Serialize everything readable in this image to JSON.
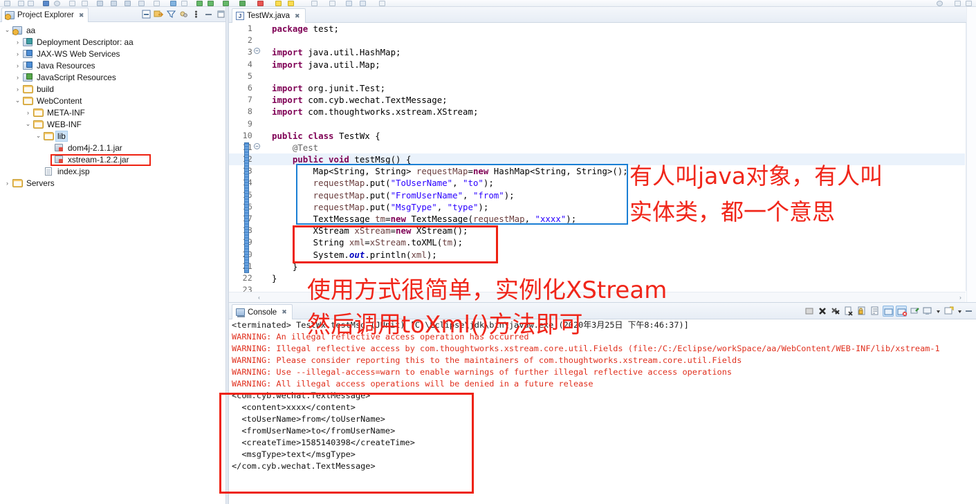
{
  "window": {
    "ide": "Eclipse IDE"
  },
  "project_explorer": {
    "tab_label": "Project Explorer",
    "tab_close": "✖",
    "tools": [
      {
        "name": "collapse-all-icon",
        "title": "Collapse All"
      },
      {
        "name": "link-with-editor-icon",
        "title": "Link with Editor"
      },
      {
        "name": "filter-icon",
        "title": "Filters"
      },
      {
        "name": "customize-view-icon",
        "title": "Customize View"
      },
      {
        "name": "view-menu-icon",
        "title": "View Menu"
      },
      {
        "name": "minimize-icon",
        "title": "Minimize"
      },
      {
        "name": "maximize-icon",
        "title": "Maximize"
      }
    ],
    "tree": [
      {
        "label": "aa",
        "depth": 0,
        "arrow": "⌄",
        "icon": "project-icon",
        "selected": false
      },
      {
        "label": "Deployment Descriptor: aa",
        "depth": 1,
        "arrow": "›",
        "icon": "deployment-descriptor-icon",
        "selected": false
      },
      {
        "label": "JAX-WS Web Services",
        "depth": 1,
        "arrow": "›",
        "icon": "web-services-icon",
        "selected": false
      },
      {
        "label": "Java Resources",
        "depth": 1,
        "arrow": "›",
        "icon": "java-resources-icon",
        "selected": false
      },
      {
        "label": "JavaScript Resources",
        "depth": 1,
        "arrow": "›",
        "icon": "javascript-resources-icon",
        "selected": false
      },
      {
        "label": "build",
        "depth": 1,
        "arrow": "›",
        "icon": "folder-icon",
        "selected": false
      },
      {
        "label": "WebContent",
        "depth": 1,
        "arrow": "⌄",
        "icon": "folder-icon",
        "selected": false
      },
      {
        "label": "META-INF",
        "depth": 2,
        "arrow": "›",
        "icon": "folder-icon",
        "selected": false
      },
      {
        "label": "WEB-INF",
        "depth": 2,
        "arrow": "⌄",
        "icon": "folder-icon",
        "selected": false
      },
      {
        "label": "lib",
        "depth": 3,
        "arrow": "⌄",
        "icon": "folder-icon",
        "selected": true
      },
      {
        "label": "dom4j-2.1.1.jar",
        "depth": 4,
        "arrow": "",
        "icon": "jar-icon",
        "selected": false
      },
      {
        "label": "xstream-1.2.2.jar",
        "depth": 4,
        "arrow": "",
        "icon": "jar-icon",
        "selected": false
      },
      {
        "label": "index.jsp",
        "depth": 3,
        "arrow": "",
        "icon": "jsp-file-icon",
        "selected": false
      },
      {
        "label": "Servers",
        "depth": 0,
        "arrow": "›",
        "icon": "folder-icon",
        "selected": false
      }
    ]
  },
  "editor": {
    "tab_label": "TestWx.java",
    "tab_icon_letter": "J",
    "tab_close": "✖",
    "code_lines": [
      {
        "num": "1",
        "fold": "",
        "highlight": false,
        "tokens": [
          {
            "t": "kw",
            "s": "package"
          },
          {
            "t": "pln",
            "s": " test;"
          }
        ]
      },
      {
        "num": "2",
        "fold": "",
        "highlight": false,
        "tokens": []
      },
      {
        "num": "3",
        "fold": "⊖",
        "highlight": false,
        "tokens": [
          {
            "t": "kw",
            "s": "import"
          },
          {
            "t": "pln",
            "s": " java.util.HashMap;"
          }
        ]
      },
      {
        "num": "4",
        "fold": "",
        "highlight": false,
        "tokens": [
          {
            "t": "kw",
            "s": "import"
          },
          {
            "t": "pln",
            "s": " java.util.Map;"
          }
        ]
      },
      {
        "num": "5",
        "fold": "",
        "highlight": false,
        "tokens": []
      },
      {
        "num": "6",
        "fold": "",
        "highlight": false,
        "tokens": [
          {
            "t": "kw",
            "s": "import"
          },
          {
            "t": "pln",
            "s": " org.junit.Test;"
          }
        ]
      },
      {
        "num": "7",
        "fold": "",
        "highlight": false,
        "tokens": [
          {
            "t": "kw",
            "s": "import"
          },
          {
            "t": "pln",
            "s": " com.cyb.wechat.TextMessage;"
          }
        ]
      },
      {
        "num": "8",
        "fold": "",
        "highlight": false,
        "tokens": [
          {
            "t": "kw",
            "s": "import"
          },
          {
            "t": "pln",
            "s": " com.thoughtworks.xstream.XStream;"
          }
        ]
      },
      {
        "num": "9",
        "fold": "",
        "highlight": false,
        "tokens": []
      },
      {
        "num": "10",
        "fold": "",
        "highlight": false,
        "tokens": [
          {
            "t": "kw",
            "s": "public class"
          },
          {
            "t": "pln",
            "s": " TestWx {"
          }
        ]
      },
      {
        "num": "11",
        "fold": "⊖",
        "highlight": false,
        "tokens": [
          {
            "t": "ann",
            "s": "    @Test"
          }
        ]
      },
      {
        "num": "12",
        "fold": "",
        "highlight": true,
        "tokens": [
          {
            "t": "kw",
            "s": "    public void"
          },
          {
            "t": "pln",
            "s": " testMsg() {"
          }
        ]
      },
      {
        "num": "13",
        "fold": "",
        "highlight": false,
        "tokens": [
          {
            "t": "pln",
            "s": "        Map<String, String> "
          },
          {
            "t": "loc",
            "s": "requestMap"
          },
          {
            "t": "pln",
            "s": "="
          },
          {
            "t": "kw",
            "s": "new"
          },
          {
            "t": "pln",
            "s": " HashMap<String, String>();"
          }
        ]
      },
      {
        "num": "14",
        "fold": "",
        "highlight": false,
        "tokens": [
          {
            "t": "loc",
            "s": "        requestMap"
          },
          {
            "t": "pln",
            "s": ".put("
          },
          {
            "t": "str",
            "s": "\"ToUserName\""
          },
          {
            "t": "pln",
            "s": ", "
          },
          {
            "t": "str",
            "s": "\"to\""
          },
          {
            "t": "pln",
            "s": ");"
          }
        ]
      },
      {
        "num": "15",
        "fold": "",
        "highlight": false,
        "tokens": [
          {
            "t": "loc",
            "s": "        requestMap"
          },
          {
            "t": "pln",
            "s": ".put("
          },
          {
            "t": "str",
            "s": "\"FromUserName\""
          },
          {
            "t": "pln",
            "s": ", "
          },
          {
            "t": "str",
            "s": "\"from\""
          },
          {
            "t": "pln",
            "s": ");"
          }
        ]
      },
      {
        "num": "16",
        "fold": "",
        "highlight": false,
        "tokens": [
          {
            "t": "loc",
            "s": "        requestMap"
          },
          {
            "t": "pln",
            "s": ".put("
          },
          {
            "t": "str",
            "s": "\"MsgType\""
          },
          {
            "t": "pln",
            "s": ", "
          },
          {
            "t": "str",
            "s": "\"type\""
          },
          {
            "t": "pln",
            "s": ");"
          }
        ]
      },
      {
        "num": "17",
        "fold": "",
        "highlight": false,
        "tokens": [
          {
            "t": "pln",
            "s": "        TextMessage "
          },
          {
            "t": "loc",
            "s": "tm"
          },
          {
            "t": "pln",
            "s": "="
          },
          {
            "t": "kw",
            "s": "new"
          },
          {
            "t": "pln",
            "s": " TextMessage("
          },
          {
            "t": "loc",
            "s": "requestMap"
          },
          {
            "t": "pln",
            "s": ", "
          },
          {
            "t": "str",
            "s": "\"xxxx\""
          },
          {
            "t": "pln",
            "s": ");"
          }
        ]
      },
      {
        "num": "18",
        "fold": "",
        "highlight": false,
        "tokens": [
          {
            "t": "pln",
            "s": "        XStream "
          },
          {
            "t": "loc",
            "s": "xStream"
          },
          {
            "t": "pln",
            "s": "="
          },
          {
            "t": "kw",
            "s": "new"
          },
          {
            "t": "pln",
            "s": " XStream();"
          }
        ]
      },
      {
        "num": "19",
        "fold": "",
        "highlight": false,
        "tokens": [
          {
            "t": "pln",
            "s": "        String "
          },
          {
            "t": "loc",
            "s": "xml"
          },
          {
            "t": "pln",
            "s": "="
          },
          {
            "t": "loc",
            "s": "xStream"
          },
          {
            "t": "pln",
            "s": ".toXML("
          },
          {
            "t": "loc",
            "s": "tm"
          },
          {
            "t": "pln",
            "s": ");"
          }
        ]
      },
      {
        "num": "20",
        "fold": "",
        "highlight": false,
        "tokens": [
          {
            "t": "pln",
            "s": "        System."
          },
          {
            "t": "fld",
            "s": "out"
          },
          {
            "t": "pln",
            "s": ".println("
          },
          {
            "t": "loc",
            "s": "xml"
          },
          {
            "t": "pln",
            "s": ");"
          }
        ]
      },
      {
        "num": "21",
        "fold": "",
        "highlight": false,
        "tokens": [
          {
            "t": "pln",
            "s": "    }"
          }
        ]
      },
      {
        "num": "22",
        "fold": "",
        "highlight": false,
        "tokens": [
          {
            "t": "pln",
            "s": "}"
          }
        ]
      },
      {
        "num": "23",
        "fold": "",
        "highlight": false,
        "tokens": []
      }
    ],
    "hscroll_left_arrow": "‹",
    "hscroll_right_arrow": "›"
  },
  "console": {
    "tab_label": "Console",
    "tab_close": "✖",
    "tools": [
      {
        "name": "clear-console-icon",
        "title": "Clear Console"
      },
      {
        "name": "terminate-icon",
        "title": "Terminate"
      },
      {
        "name": "remove-all-terminated-icon",
        "title": "Remove All Terminated Launches"
      },
      {
        "name": "remove-launch-icon",
        "title": "Remove Launch"
      },
      {
        "name": "lock-scroll-icon",
        "title": "Scroll Lock"
      },
      {
        "name": "word-wrap-icon",
        "title": "Word Wrap"
      },
      {
        "name": "show-console-on-output-icon",
        "title": "Show Console When Standard Out Changes"
      },
      {
        "name": "show-console-on-error-icon",
        "title": "Show Console When Standard Error Changes"
      },
      {
        "name": "pin-console-icon",
        "title": "Pin Console"
      },
      {
        "name": "display-selected-console-icon",
        "title": "Display Selected Console"
      },
      {
        "name": "display-selected-console-menu-icon",
        "title": "Open Console Menu"
      },
      {
        "name": "new-console-view-icon",
        "title": "New Console View"
      },
      {
        "name": "new-console-menu-icon",
        "title": "New Console Menu"
      },
      {
        "name": "minimize-icon",
        "title": "Minimize"
      }
    ],
    "lines": [
      {
        "kind": "term",
        "text": "<terminated> TestWx.testMsg (JUnit) [C:\\Eclipse\\jdk\\bin\\javaw.exe (2020年3月25日 下午8:46:37)]"
      },
      {
        "kind": "warn",
        "text": "WARNING: An illegal reflective access operation has occurred"
      },
      {
        "kind": "warn",
        "text": "WARNING: Illegal reflective access by com.thoughtworks.xstream.core.util.Fields (file:/C:/Eclipse/workSpace/aa/WebContent/WEB-INF/lib/xstream-1"
      },
      {
        "kind": "warn",
        "text": "WARNING: Please consider reporting this to the maintainers of com.thoughtworks.xstream.core.util.Fields"
      },
      {
        "kind": "warn",
        "text": "WARNING: Use --illegal-access=warn to enable warnings of further illegal reflective access operations"
      },
      {
        "kind": "warn",
        "text": "WARNING: All illegal access operations will be denied in a future release"
      },
      {
        "kind": "out",
        "text": "<com.cyb.wechat.TextMessage>"
      },
      {
        "kind": "out",
        "text": "  <content>xxxx</content>"
      },
      {
        "kind": "out",
        "text": "  <toUserName>from</toUserName>"
      },
      {
        "kind": "out",
        "text": "  <fromUserName>to</fromUserName>"
      },
      {
        "kind": "out",
        "text": "  <createTime>1585140398</createTime>"
      },
      {
        "kind": "out",
        "text": "  <msgType>text</msgType>"
      },
      {
        "kind": "out",
        "text": "</com.cyb.wechat.TextMessage>"
      }
    ]
  },
  "annotations": {
    "note_java_object_line1": "有人叫java对象，有人叫",
    "note_java_object_line2": "实体类，都一个意思",
    "note_usage_line1": "使用方式很简单，实例化XStream",
    "note_usage_line2": "然后调用toXml()方法即可",
    "colors": {
      "annotation_red": "#f0261a",
      "box_red": "#ee2211",
      "box_blue": "#1a7fd4"
    }
  }
}
